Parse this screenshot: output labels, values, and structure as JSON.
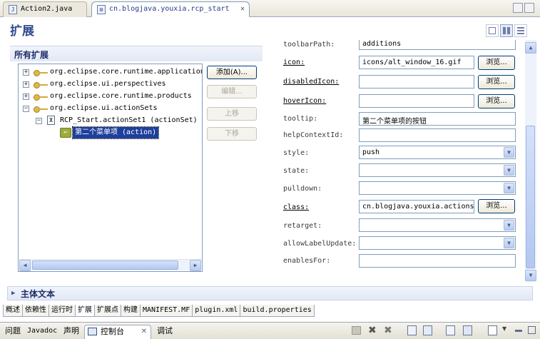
{
  "editor_tabs": [
    {
      "label": "Action2.java",
      "icon": "java-file-icon"
    },
    {
      "label": "cn.blogjava.youxia.rcp_start",
      "icon": "plugin-icon"
    }
  ],
  "page_title": "扩展",
  "all_extensions": {
    "title": "所有扩展",
    "tree": [
      "org.eclipse.core.runtime.applications",
      "org.eclipse.ui.perspectives",
      "org.eclipse.core.runtime.products",
      "org.eclipse.ui.actionSets",
      "RCP_Start.actionSet1 (actionSet)",
      "第二个菜单项 (action)"
    ],
    "expanders": [
      "+",
      "+",
      "+",
      "−",
      "−"
    ],
    "buttons": {
      "add": "添加(A)...",
      "edit": "编辑...",
      "up": "上移",
      "down": "下移"
    }
  },
  "details": {
    "toolbarPath": {
      "label": "toolbarPath:",
      "value": "additions"
    },
    "icon": {
      "label": "icon:",
      "value": "icons/alt_window_16.gif"
    },
    "disabledIcon": {
      "label": "disabledIcon:",
      "value": ""
    },
    "hoverIcon": {
      "label": "hoverIcon:",
      "value": ""
    },
    "tooltip": {
      "label": "tooltip:",
      "value": "第二个菜单项的按钮"
    },
    "helpContextId": {
      "label": "helpContextId:",
      "value": ""
    },
    "style": {
      "label": "style:",
      "value": "push"
    },
    "state": {
      "label": "state:",
      "value": ""
    },
    "pulldown": {
      "label": "pulldown:",
      "value": ""
    },
    "class": {
      "label": "class:",
      "value": "cn.blogjava.youxia.actions"
    },
    "retarget": {
      "label": "retarget:",
      "value": ""
    },
    "allowLabelUpdate": {
      "label": "allowLabelUpdate:",
      "value": ""
    },
    "enablesFor": {
      "label": "enablesFor:",
      "value": ""
    },
    "browse_label": "浏览..."
  },
  "body_text_section": "主体文本",
  "page_tabs": [
    "概述",
    "依赖性",
    "运行时",
    "扩展",
    "扩展点",
    "构建",
    "MANIFEST.MF",
    "plugin.xml",
    "build.properties"
  ],
  "view_tabs": [
    "问题",
    "Javadoc",
    "声明",
    "控制台",
    "调试"
  ],
  "colors": {
    "accent": "#2f4a8f",
    "selection": "#1e3f9c"
  }
}
